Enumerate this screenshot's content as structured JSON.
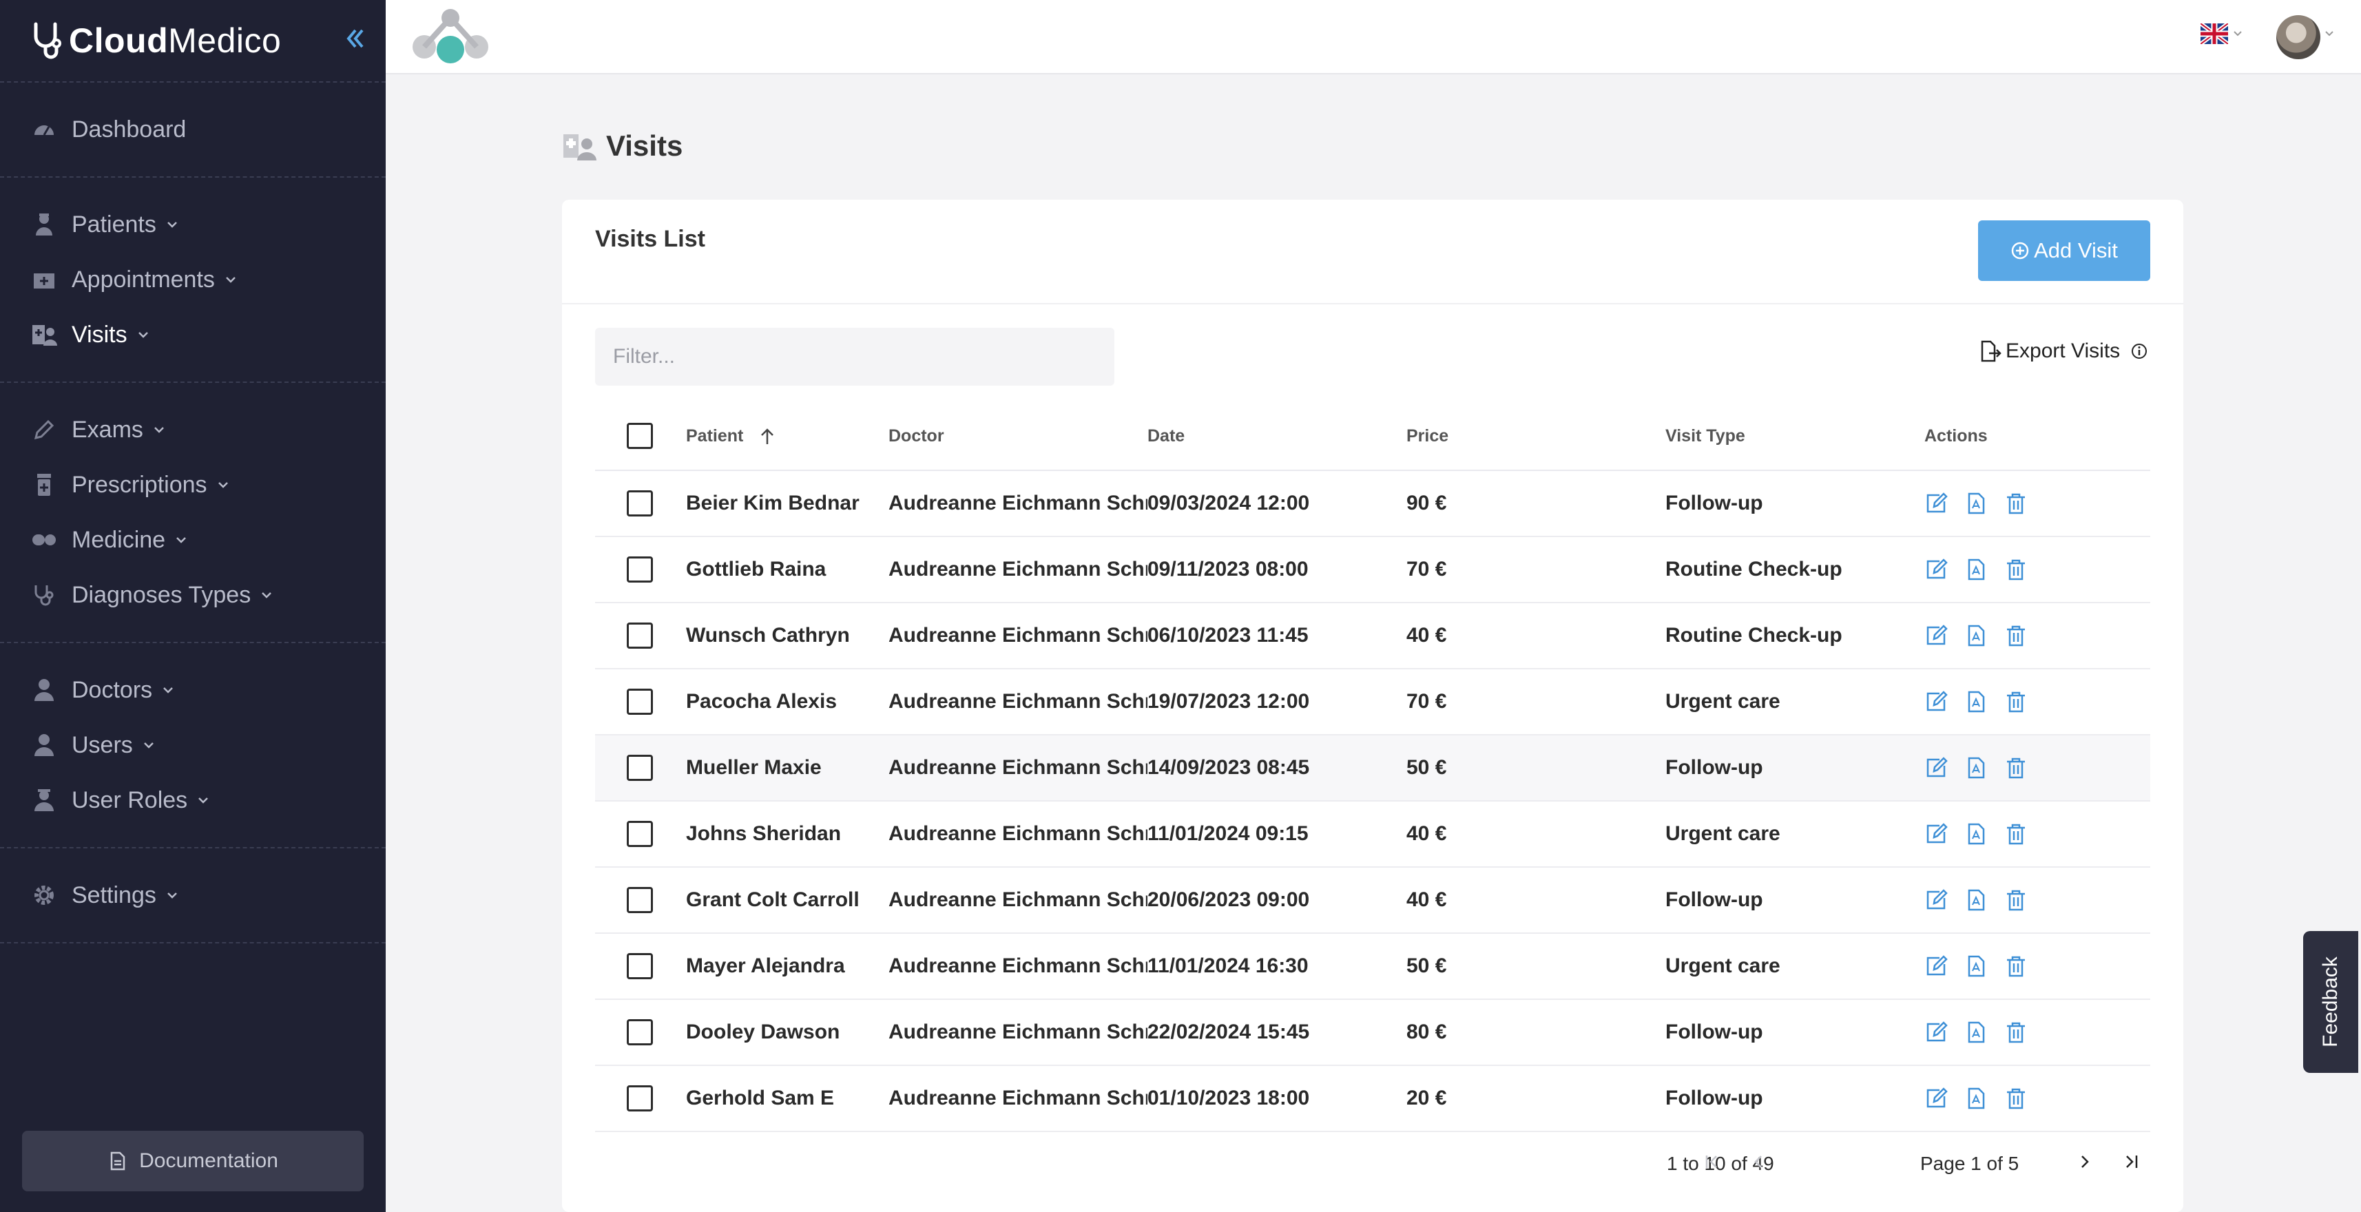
{
  "brand": {
    "bold": "Cloud",
    "regular": "Medico"
  },
  "sidebar": {
    "groups": [
      [
        {
          "label": "Dashboard",
          "icon": "gauge-icon",
          "chevron": false
        }
      ],
      [
        {
          "label": "Patients",
          "icon": "patient-icon",
          "chevron": true
        },
        {
          "label": "Appointments",
          "icon": "appointment-icon",
          "chevron": true
        },
        {
          "label": "Visits",
          "icon": "visits-icon",
          "chevron": true,
          "active": true
        }
      ],
      [
        {
          "label": "Exams",
          "icon": "pencil-icon",
          "chevron": true
        },
        {
          "label": "Prescriptions",
          "icon": "prescription-icon",
          "chevron": true
        },
        {
          "label": "Medicine",
          "icon": "pills-icon",
          "chevron": true
        },
        {
          "label": "Diagnoses Types",
          "icon": "stethoscope-icon",
          "chevron": true
        }
      ],
      [
        {
          "label": "Doctors",
          "icon": "doctor-icon",
          "chevron": true
        },
        {
          "label": "Users",
          "icon": "user-icon",
          "chevron": true
        },
        {
          "label": "User Roles",
          "icon": "user-roles-icon",
          "chevron": true
        }
      ],
      [
        {
          "label": "Settings",
          "icon": "gear-icon",
          "chevron": true
        }
      ]
    ],
    "documentation": "Documentation"
  },
  "header": {
    "language_icon": "uk-flag-icon"
  },
  "page": {
    "title": "Visits"
  },
  "card": {
    "title": "Visits List",
    "add_button": "Add Visit",
    "filter_placeholder": "Filter...",
    "export_label": "Export Visits"
  },
  "table": {
    "columns": [
      "Patient",
      "Doctor",
      "Date",
      "Price",
      "Visit Type",
      "Actions"
    ],
    "rows": [
      {
        "patient": "Beier Kim Bednar",
        "doctor": "Audreanne Eichmann Schmidt",
        "date": "09/03/2024 12:00",
        "price": "90 €",
        "type": "Follow-up"
      },
      {
        "patient": "Gottlieb Raina",
        "doctor": "Audreanne Eichmann Schmidt",
        "date": "09/11/2023 08:00",
        "price": "70 €",
        "type": "Routine Check-up"
      },
      {
        "patient": "Wunsch Cathryn",
        "doctor": "Audreanne Eichmann Schmidt",
        "date": "06/10/2023 11:45",
        "price": "40 €",
        "type": "Routine Check-up"
      },
      {
        "patient": "Pacocha Alexis",
        "doctor": "Audreanne Eichmann Schmidt",
        "date": "19/07/2023 12:00",
        "price": "70 €",
        "type": "Urgent care"
      },
      {
        "patient": "Mueller Maxie",
        "doctor": "Audreanne Eichmann Schmidt",
        "date": "14/09/2023 08:45",
        "price": "50 €",
        "type": "Follow-up"
      },
      {
        "patient": "Johns Sheridan",
        "doctor": "Audreanne Eichmann Schmidt",
        "date": "11/01/2024 09:15",
        "price": "40 €",
        "type": "Urgent care"
      },
      {
        "patient": "Grant Colt Carroll",
        "doctor": "Audreanne Eichmann Schmidt",
        "date": "20/06/2023 09:00",
        "price": "40 €",
        "type": "Follow-up"
      },
      {
        "patient": "Mayer Alejandra",
        "doctor": "Audreanne Eichmann Schmidt",
        "date": "11/01/2024 16:30",
        "price": "50 €",
        "type": "Urgent care"
      },
      {
        "patient": "Dooley Dawson",
        "doctor": "Audreanne Eichmann Schmidt",
        "date": "22/02/2024 15:45",
        "price": "80 €",
        "type": "Follow-up"
      },
      {
        "patient": "Gerhold Sam E",
        "doctor": "Audreanne Eichmann Schmidt",
        "date": "01/10/2023 18:00",
        "price": "20 €",
        "type": "Follow-up"
      }
    ]
  },
  "pagination": {
    "range": "1 to 10 of 49",
    "page_label": "Page 1 of 5"
  },
  "feedback": "Feedback",
  "colors": {
    "sidebar": "#1f2133",
    "accent": "#5aa8e6",
    "action_icon": "#3d8fd6"
  }
}
